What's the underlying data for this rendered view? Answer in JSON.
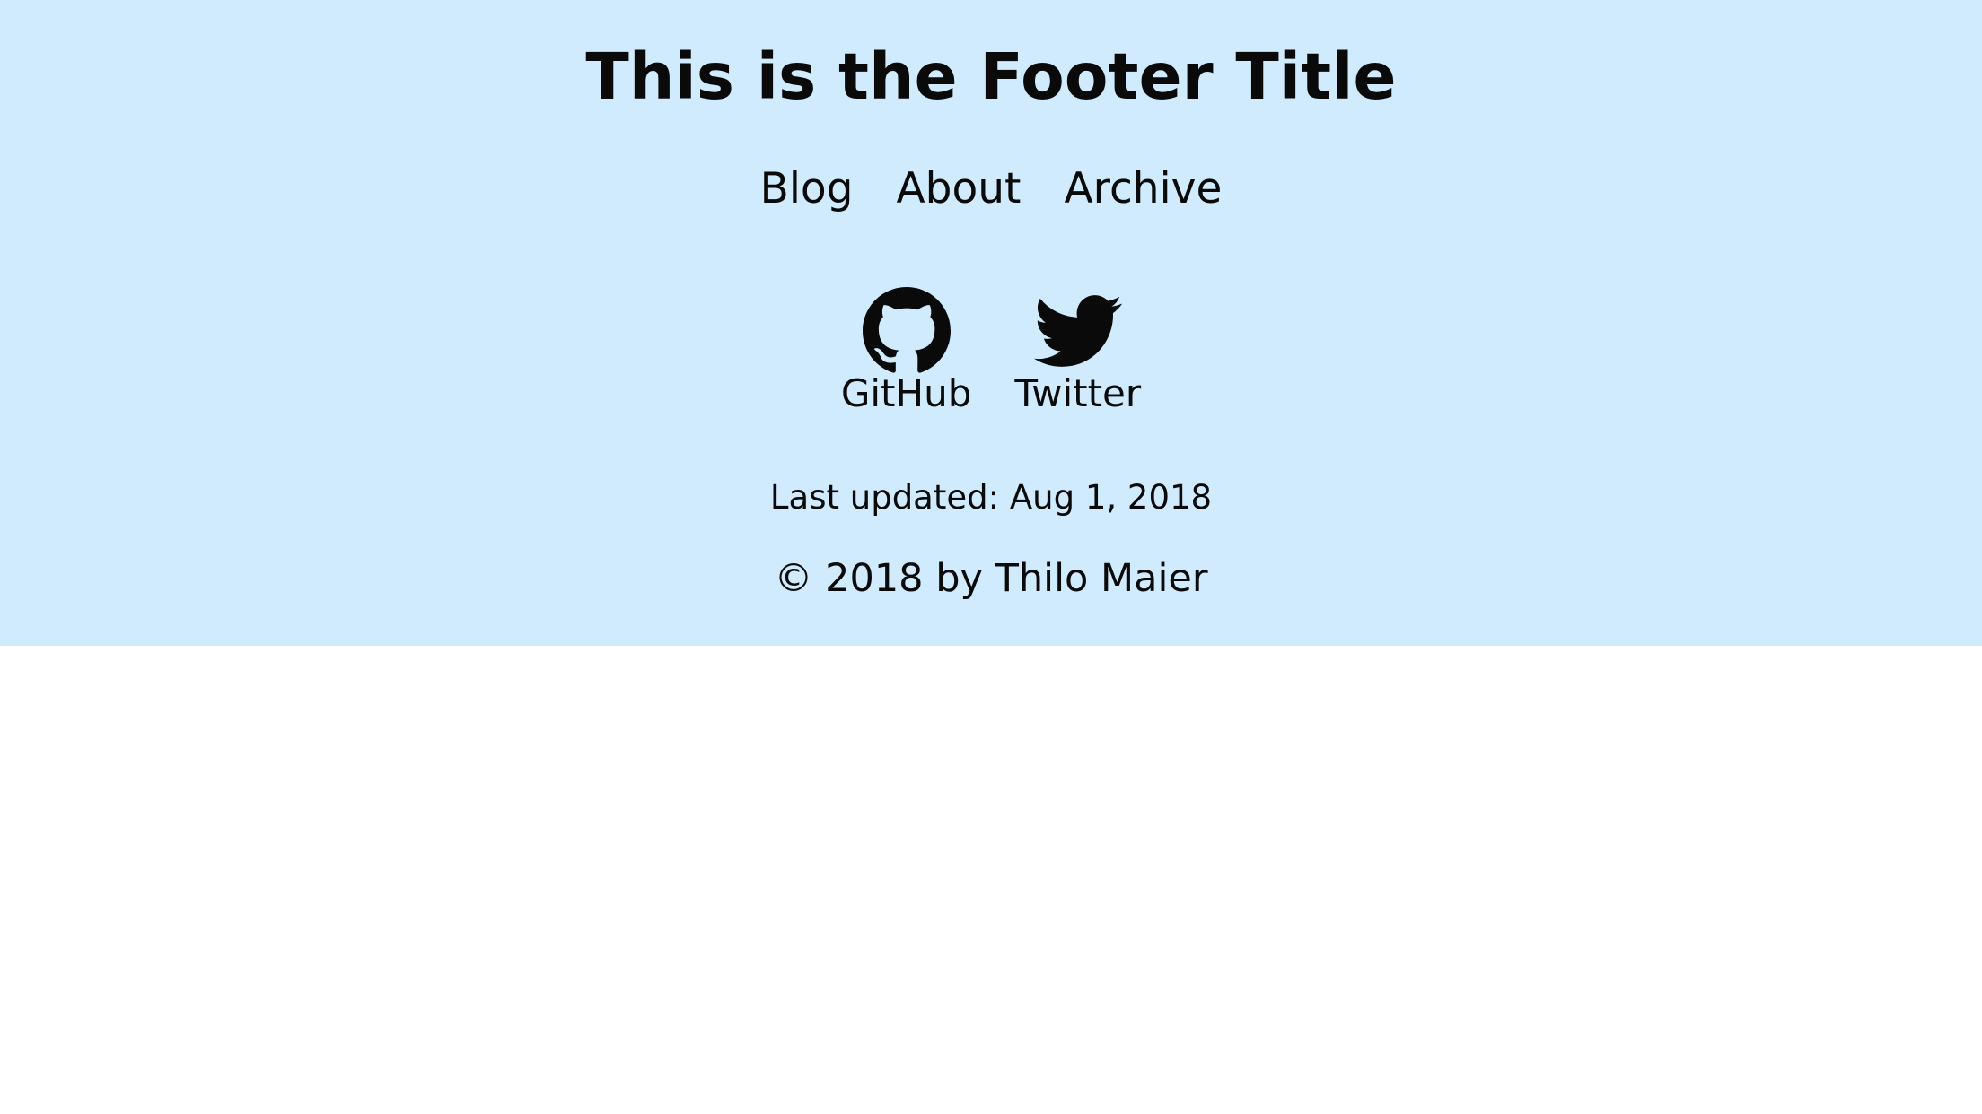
{
  "footer": {
    "title": "This is the Footer Title",
    "nav": [
      {
        "label": "Blog"
      },
      {
        "label": "About"
      },
      {
        "label": "Archive"
      }
    ],
    "social": [
      {
        "label": "GitHub",
        "icon": "github-icon"
      },
      {
        "label": "Twitter",
        "icon": "twitter-icon"
      }
    ],
    "last_updated": "Last updated: Aug 1, 2018",
    "copyright": "© 2018 by Thilo Maier"
  },
  "colors": {
    "footer_background": "#cfebfd",
    "text": "#0a0a0a",
    "page_background": "#ffffff"
  }
}
